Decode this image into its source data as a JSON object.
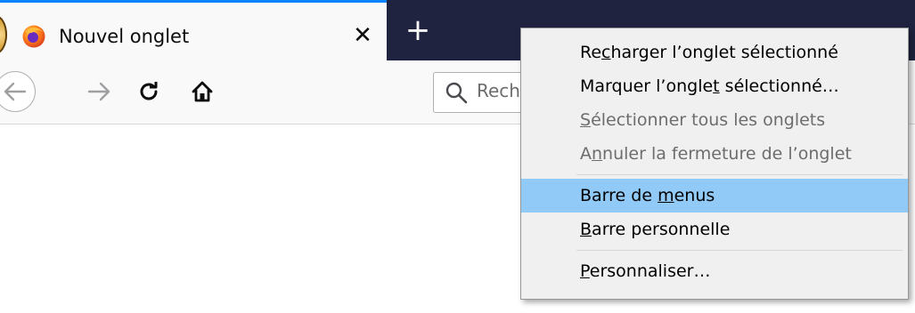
{
  "tab": {
    "title": "Nouvel onglet",
    "close_glyph": "✕",
    "favicon": "firefox-icon"
  },
  "tabstrip": {
    "newtab_glyph": "+"
  },
  "navbar": {
    "icons": [
      "back-arrow-icon",
      "forward-arrow-icon",
      "reload-icon",
      "home-icon",
      "search-icon"
    ],
    "search_placeholder": "Rechercher"
  },
  "context_menu": {
    "items": [
      {
        "before": "Re",
        "key": "c",
        "after": "harger l’onglet sélectionné",
        "disabled": false
      },
      {
        "before": "Marquer l’ongle",
        "key": "t",
        "after": " sélectionné…",
        "disabled": false
      },
      {
        "before": "",
        "key": "S",
        "after": "électionner tous les onglets",
        "disabled": true
      },
      {
        "before": "A",
        "key": "n",
        "after": "nuler la fermeture de l’onglet",
        "disabled": true
      },
      {
        "before": "Barre de ",
        "key": "m",
        "after": "enus",
        "disabled": false,
        "highlighted": true
      },
      {
        "before": "",
        "key": "B",
        "after": "arre personnelle",
        "disabled": false
      },
      {
        "before": "",
        "key": "P",
        "after": "ersonnaliser…",
        "disabled": false
      }
    ]
  },
  "colors": {
    "tabstrip_bg": "#202340",
    "tab_accent": "#0a84ff",
    "menu_bg": "#f0f0f0",
    "menu_highlight": "#91c9f7"
  }
}
